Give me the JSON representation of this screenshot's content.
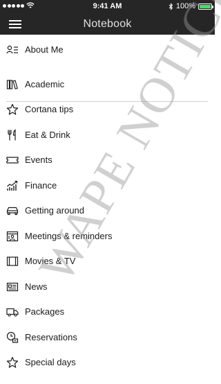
{
  "status_bar": {
    "time": "9:41 AM",
    "battery": "100%",
    "battery_level": 1.0
  },
  "nav": {
    "title": "Notebook"
  },
  "items": [
    {
      "label": "About Me",
      "icon": "profile-icon"
    },
    {
      "label": "Academic",
      "icon": "books-icon"
    },
    {
      "label": "Cortana tips",
      "icon": "star-icon"
    },
    {
      "label": "Eat & Drink",
      "icon": "fork-knife-icon"
    },
    {
      "label": "Events",
      "icon": "ticket-icon"
    },
    {
      "label": "Finance",
      "icon": "chart-icon"
    },
    {
      "label": "Getting around",
      "icon": "car-icon"
    },
    {
      "label": "Meetings & reminders",
      "icon": "meeting-icon"
    },
    {
      "label": "Movies & TV",
      "icon": "film-icon"
    },
    {
      "label": "News",
      "icon": "news-icon"
    },
    {
      "label": "Packages",
      "icon": "truck-icon"
    },
    {
      "label": "Reservations",
      "icon": "reservation-icon"
    },
    {
      "label": "Special days",
      "icon": "star-icon"
    }
  ],
  "watermark": {
    "text": "WAPE NOTICE"
  }
}
